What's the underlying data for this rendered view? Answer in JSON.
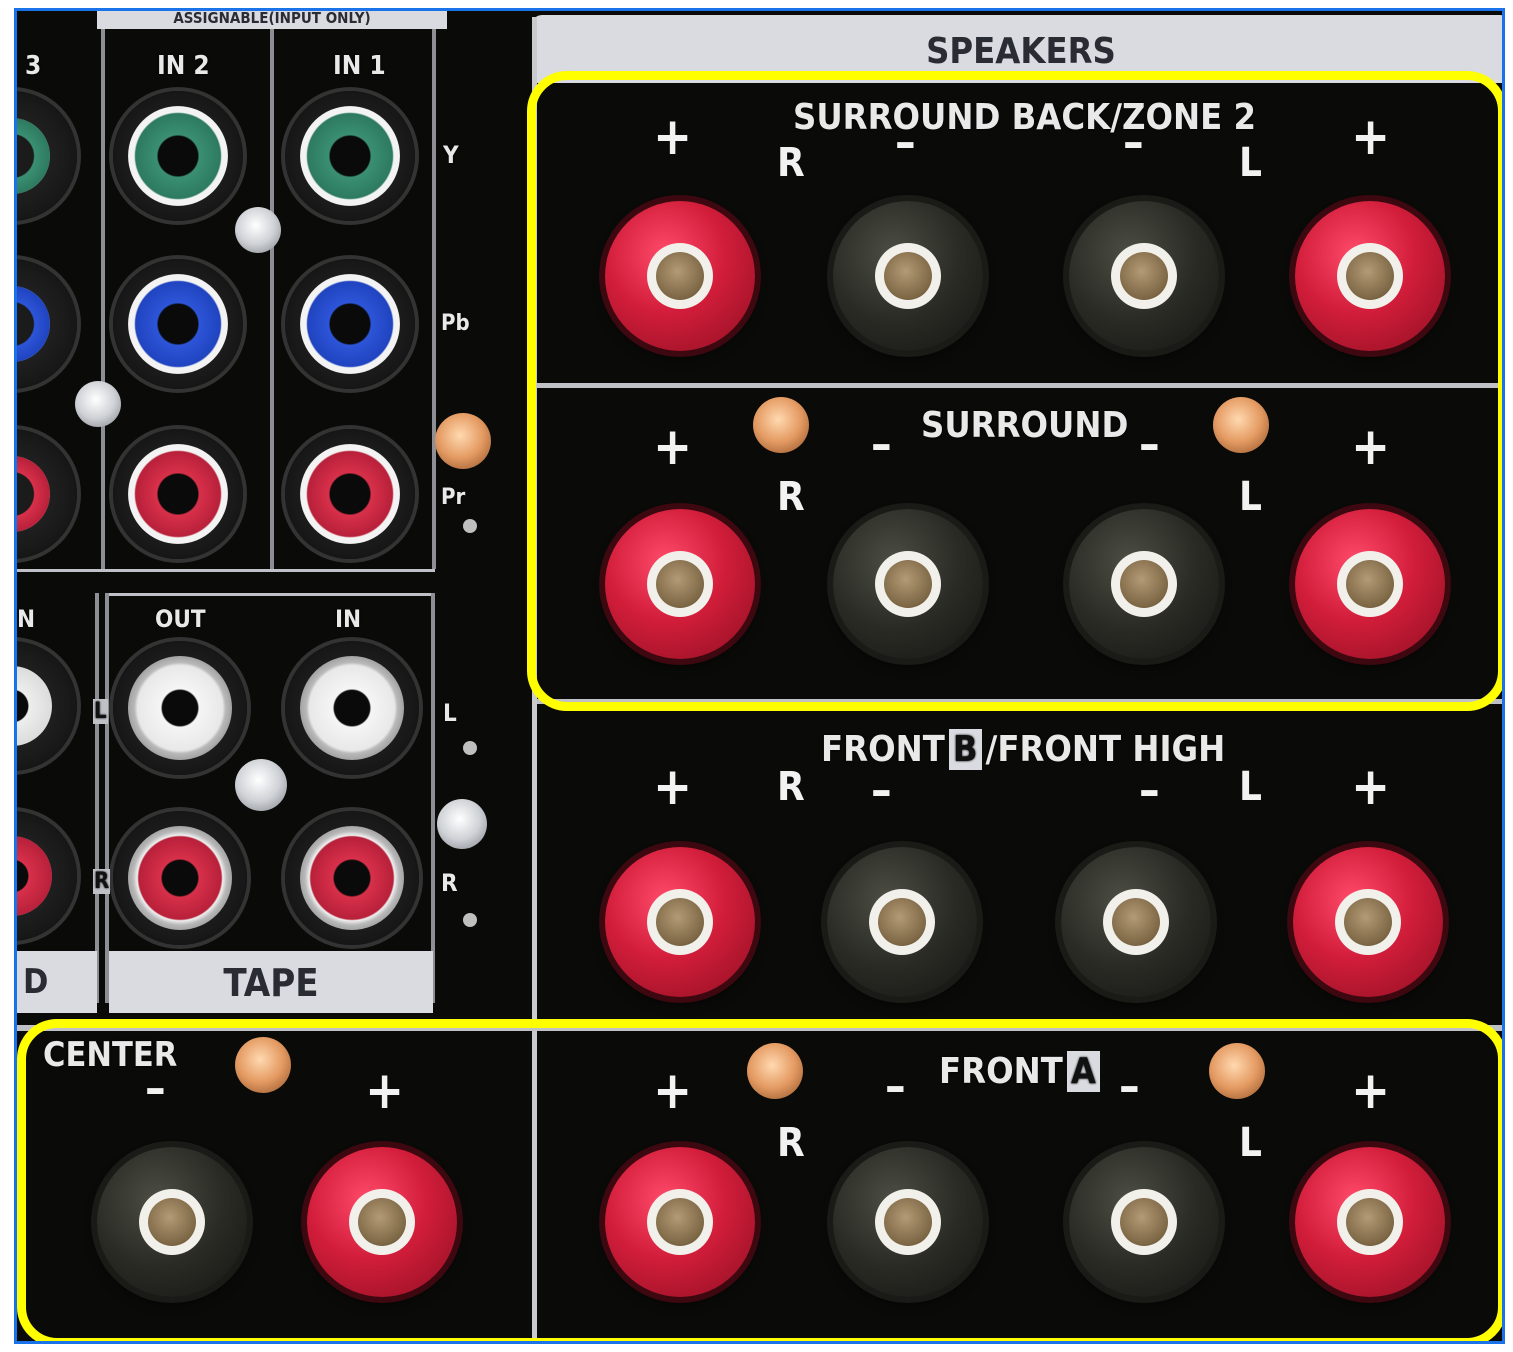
{
  "speakers": {
    "header": "SPEAKERS",
    "surround_back": {
      "title": "SURROUND BACK/ZONE 2",
      "plus": "+",
      "minus": "–",
      "right": "R",
      "left": "L"
    },
    "surround": {
      "title": "SURROUND",
      "plus": "+",
      "minus": "–",
      "right": "R",
      "left": "L"
    },
    "front_b": {
      "title_prefix": "FRONT",
      "box": "B",
      "title_suffix": "/FRONT HIGH",
      "plus": "+",
      "minus": "–",
      "right": "R",
      "left": "L"
    },
    "front_a": {
      "title_prefix": "FRONT",
      "box": "A",
      "plus": "+",
      "minus": "–",
      "right": "R",
      "left": "L"
    },
    "center": {
      "title": "CENTER",
      "plus": "+",
      "minus": "–"
    }
  },
  "video_inputs": {
    "header": "ASSIGNABLE(INPUT ONLY)",
    "col3": "3",
    "in2": "IN 2",
    "in1": "IN 1",
    "y": "Y",
    "pb": "Pb",
    "pr": "Pr"
  },
  "audio": {
    "tape_label": "TAPE",
    "out": "OUT",
    "in": "IN",
    "partial_in": "N",
    "partial_label": "D",
    "l": "L",
    "r": "R"
  },
  "colors": {
    "highlight": "#ffff00",
    "border": "#1a73e8",
    "plus_post": "#d11d3a",
    "minus_post": "#2a2b25"
  }
}
